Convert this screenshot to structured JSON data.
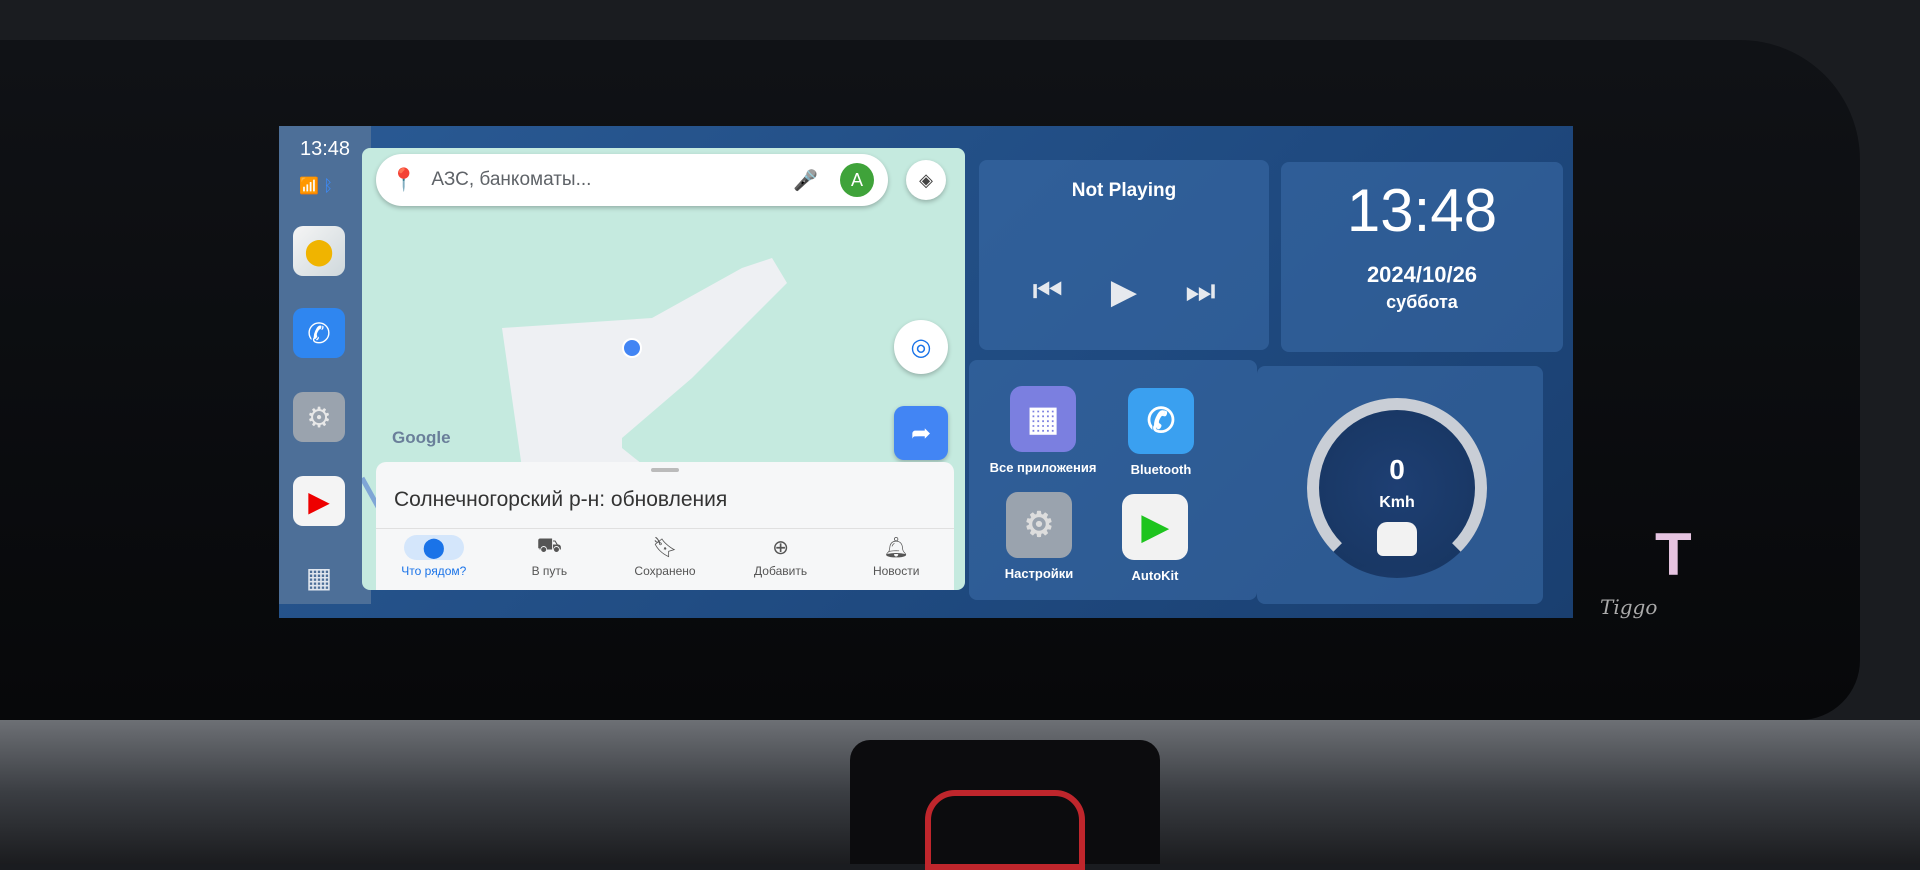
{
  "dock": {
    "time": "13:48",
    "apps": [
      {
        "name": "maps",
        "icon": "maps-icon"
      },
      {
        "name": "phone",
        "icon": "bluetooth-phone-icon"
      },
      {
        "name": "settings",
        "icon": "gear-icon"
      },
      {
        "name": "youtube",
        "icon": "youtube-icon"
      },
      {
        "name": "all-apps",
        "icon": "grid-icon"
      }
    ]
  },
  "map": {
    "search_placeholder": "АЗС, банкоматы...",
    "avatar_letter": "A",
    "watermark": "Google",
    "sheet_title": "Солнечногорский р-н: обновления",
    "tabs": [
      {
        "label": "Что рядом?",
        "icon": "pin-icon",
        "active": true
      },
      {
        "label": "В путь",
        "icon": "commute-icon"
      },
      {
        "label": "Сохранено",
        "icon": "bookmark-icon"
      },
      {
        "label": "Добавить",
        "icon": "add-circle-icon"
      },
      {
        "label": "Новости",
        "icon": "bell-icon"
      }
    ]
  },
  "media": {
    "status": "Not Playing"
  },
  "clock": {
    "time": "13:48",
    "date": "2024/10/26",
    "weekday": "суббота"
  },
  "apps": [
    {
      "label": "Все приложения",
      "color": "#7b7fe0"
    },
    {
      "label": "Bluetooth",
      "color": "#3aa0f0"
    },
    {
      "label": "Настройки",
      "color": "#9aa3ae"
    },
    {
      "label": "AutoKit",
      "color": "#f2f2f2"
    }
  ],
  "speed": {
    "value": "0",
    "unit": "Kmh"
  },
  "brand": {
    "name": "Tiggo"
  }
}
